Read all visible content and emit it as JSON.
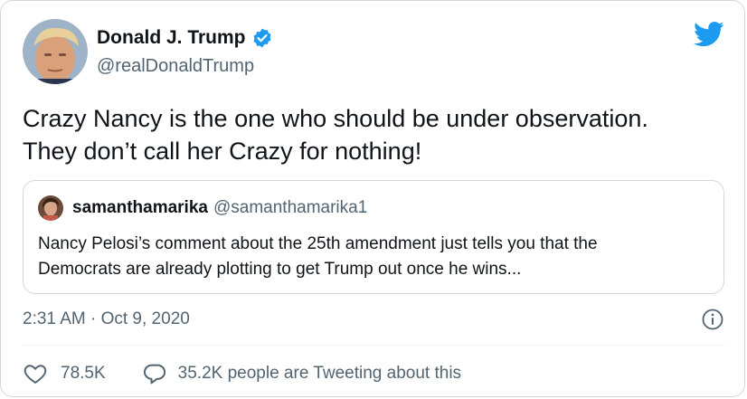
{
  "author": {
    "name": "Donald J. Trump",
    "handle": "@realDonaldTrump"
  },
  "tweet": {
    "lines": [
      "Crazy Nancy is the one who should be under observation.",
      "They don’t call her Crazy for nothing!"
    ]
  },
  "quoted_tweet": {
    "name": "samanthamarika",
    "handle": "@samanthamarika1",
    "lines": [
      "Nancy Pelosi’s comment about the 25th amendment just tells you that the",
      "Democrats are already plotting to get Trump out once he wins..."
    ]
  },
  "timestamp": "2:31 AM · Oct 9, 2020",
  "actions": {
    "likes": "78.5K",
    "replies_text": "35.2K people are Tweeting about this"
  },
  "icons": {
    "brand": "twitter-bird-icon",
    "verified": "verified-badge-icon",
    "info": "info-icon",
    "like": "heart-icon",
    "reply": "speech-bubble-icon"
  },
  "colors": {
    "brand_blue": "#1d9bf0",
    "text_primary": "#0f1419",
    "text_secondary": "#536471",
    "border": "#cfd9de"
  }
}
